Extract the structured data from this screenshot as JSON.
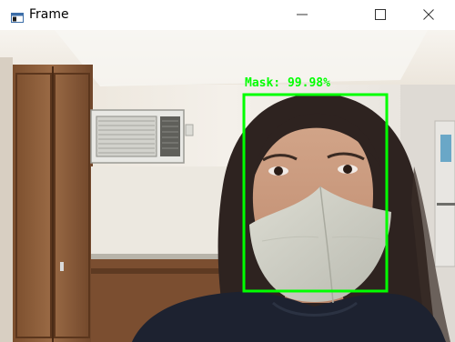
{
  "window": {
    "title": "Frame",
    "icon": "app-window-icon",
    "controls": {
      "minimize_icon": "minimize-icon",
      "maximize_icon": "maximize-icon",
      "close_icon": "close-icon"
    }
  },
  "detection": {
    "label": "Mask: 99.98%",
    "color": "#00ff00"
  },
  "scene": {
    "wall_color": "#f0ebe2",
    "cabinet_color": "#8a5a36",
    "hair_color": "#2e2320",
    "mask_color": "#cfcfc4",
    "shirt_color": "#1d2230"
  }
}
